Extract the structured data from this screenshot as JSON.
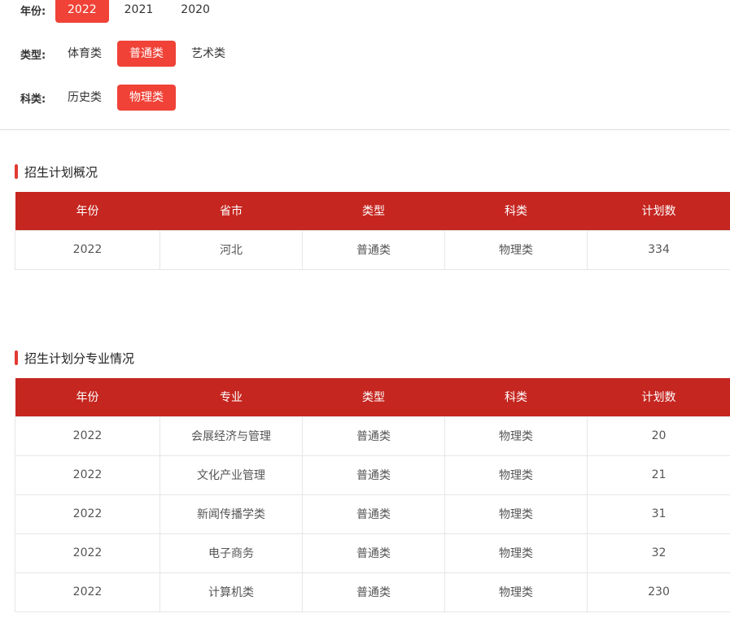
{
  "filters": {
    "year": {
      "label": "年份:",
      "options": [
        "2022",
        "2021",
        "2020"
      ],
      "selected": "2022"
    },
    "type": {
      "label": "类型:",
      "options": [
        "体育类",
        "普通类",
        "艺术类"
      ],
      "selected": "普通类"
    },
    "subject": {
      "label": "科类:",
      "options": [
        "历史类",
        "物理类"
      ],
      "selected": "物理类"
    }
  },
  "overview": {
    "title": "招生计划概况",
    "headers": [
      "年份",
      "省市",
      "类型",
      "科类",
      "计划数"
    ],
    "rows": [
      [
        "2022",
        "河北",
        "普通类",
        "物理类",
        "334"
      ]
    ]
  },
  "majors": {
    "title": "招生计划分专业情况",
    "headers": [
      "年份",
      "专业",
      "类型",
      "科类",
      "计划数"
    ],
    "rows": [
      [
        "2022",
        "会展经济与管理",
        "普通类",
        "物理类",
        "20"
      ],
      [
        "2022",
        "文化产业管理",
        "普通类",
        "物理类",
        "21"
      ],
      [
        "2022",
        "新闻传播学类",
        "普通类",
        "物理类",
        "31"
      ],
      [
        "2022",
        "电子商务",
        "普通类",
        "物理类",
        "32"
      ],
      [
        "2022",
        "计算机类",
        "普通类",
        "物理类",
        "230"
      ]
    ]
  },
  "colors": {
    "accent": "#f04237",
    "header": "#c62620",
    "bar": "#e23a32"
  }
}
